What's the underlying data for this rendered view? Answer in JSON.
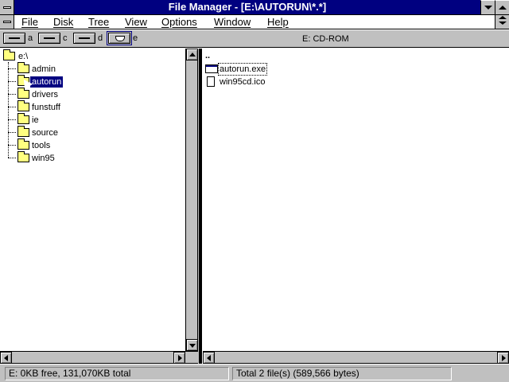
{
  "window": {
    "title": "File Manager - [E:\\AUTORUN\\*.*]"
  },
  "menu": {
    "items": [
      "File",
      "Disk",
      "Tree",
      "View",
      "Options",
      "Window",
      "Help"
    ]
  },
  "drives": {
    "items": [
      {
        "letter": "a",
        "icon": "floppy-drive-icon"
      },
      {
        "letter": "c",
        "icon": "hard-drive-icon"
      },
      {
        "letter": "d",
        "icon": "hard-drive-icon"
      },
      {
        "letter": "e",
        "icon": "cdrom-drive-icon",
        "selected": true
      }
    ],
    "current_label": "E: CD-ROM"
  },
  "tree": {
    "root": "e:\\",
    "folders": [
      "admin",
      "autorun",
      "drivers",
      "funstuff",
      "ie",
      "source",
      "tools",
      "win95"
    ],
    "selected": "autorun"
  },
  "files": {
    "up_symbol": "..",
    "items": [
      {
        "name": "autorun.exe",
        "icon": "program-file-icon"
      },
      {
        "name": "win95cd.ico",
        "icon": "document-file-icon"
      }
    ]
  },
  "status": {
    "left": "E: 0KB free,  131,070KB total",
    "right": "Total 2 file(s) (589,566 bytes)"
  }
}
